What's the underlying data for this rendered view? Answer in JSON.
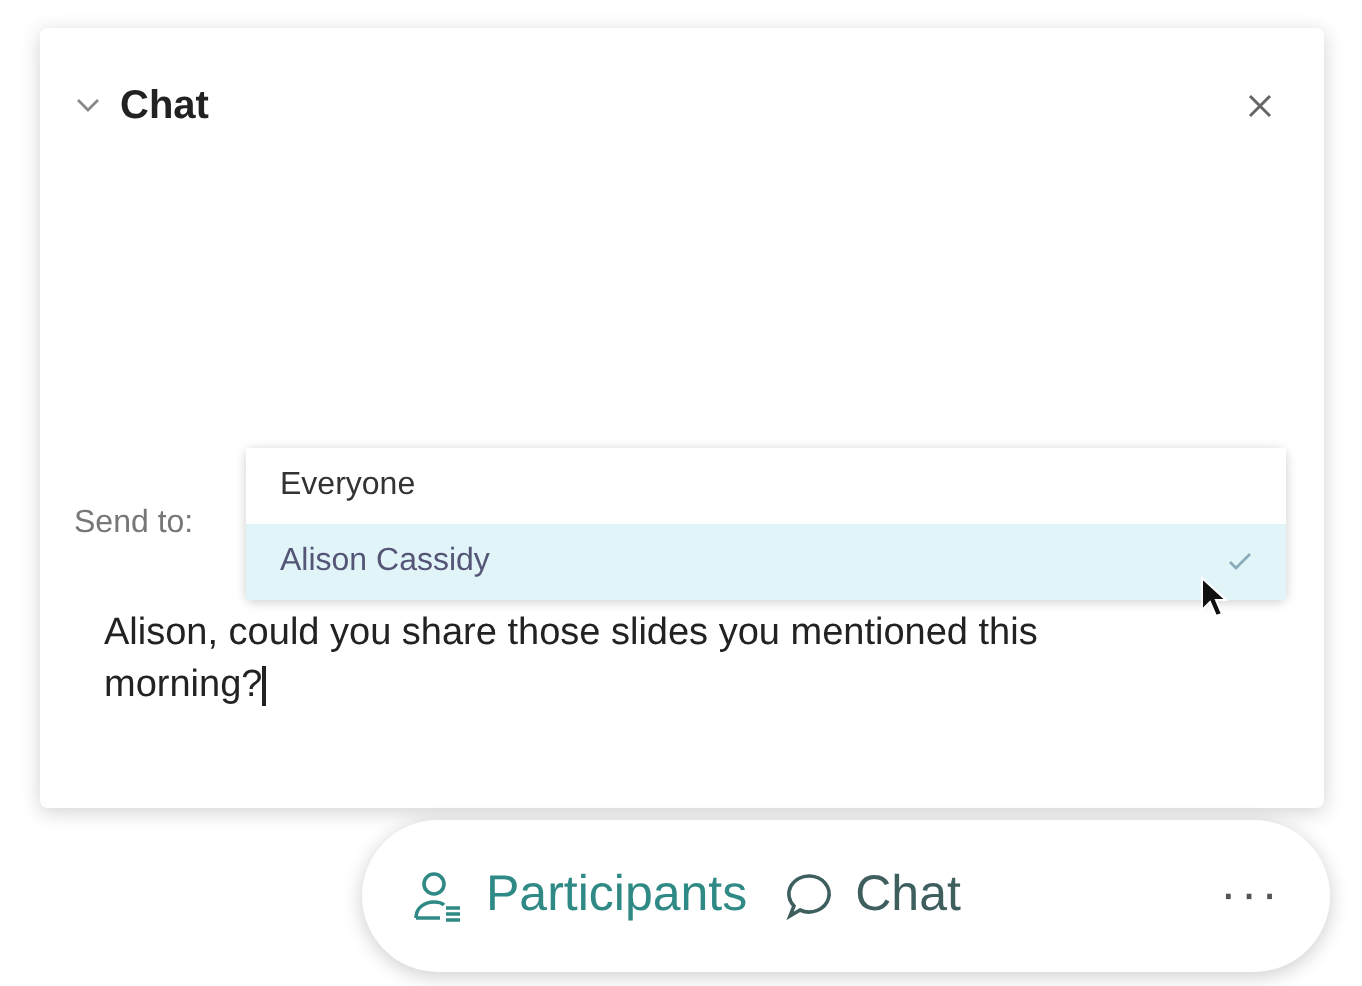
{
  "panel": {
    "title": "Chat",
    "expanded": true
  },
  "send_to": {
    "label": "Send to:",
    "options": [
      {
        "label": "Everyone",
        "selected": false
      },
      {
        "label": "Alison Cassidy",
        "selected": true
      }
    ]
  },
  "message": {
    "value": "Alison, could you share those slides you mentioned this morning?"
  },
  "toolbar": [
    {
      "kind": "participants",
      "label": "Participants"
    },
    {
      "kind": "chat",
      "label": "Chat"
    },
    {
      "kind": "more",
      "label": "···"
    }
  ]
}
